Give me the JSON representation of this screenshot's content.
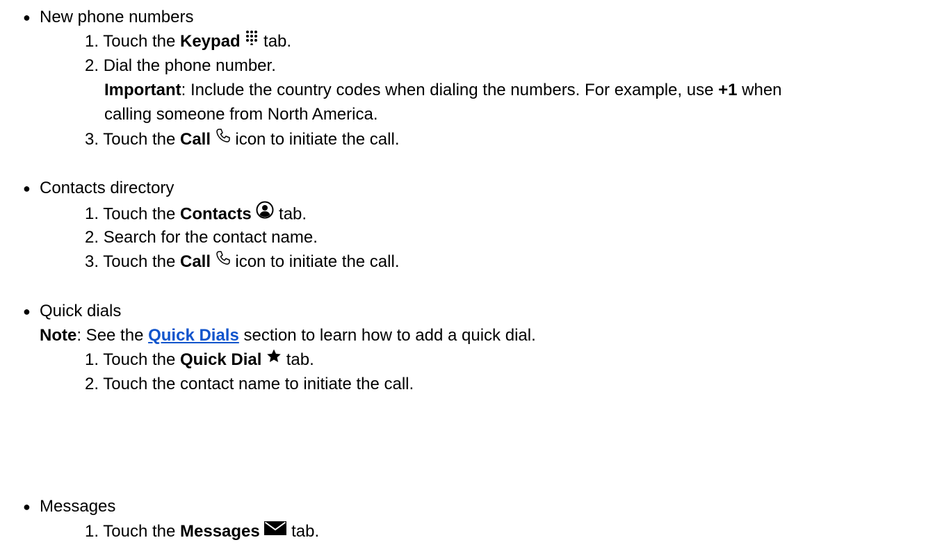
{
  "sections": [
    {
      "bullet": "●",
      "title": "New phone numbers",
      "steps": [
        {
          "num": "1.",
          "pre": "Touch the ",
          "bold": "Keypad",
          "icon": "keypad-icon",
          "post": " tab."
        },
        {
          "num": "2.",
          "text": "Dial the phone number."
        },
        {
          "num": "3.",
          "pre": "Touch the ",
          "bold": "Call",
          "icon": "phone-icon",
          "post": " icon to initiate the call."
        }
      ],
      "important": {
        "label": "Important",
        "text1": ": Include the country codes when dialing the numbers. For example, use ",
        "code": "+1",
        "text2": " when",
        "text3": "calling someone from North America."
      }
    },
    {
      "bullet": "●",
      "title": "Contacts directory",
      "steps": [
        {
          "num": "1.",
          "pre": "Touch the ",
          "bold": "Contacts",
          "icon": "contact-icon",
          "post": " tab."
        },
        {
          "num": "2.",
          "text": "Search for the contact name."
        },
        {
          "num": "3.",
          "pre": "Touch the ",
          "bold": "Call",
          "icon": "phone-icon",
          "post": " icon to initiate the call."
        }
      ]
    },
    {
      "bullet": "●",
      "title": "Quick dials",
      "note": {
        "label": "Note",
        "pre": ": See the ",
        "link": "Quick Dials",
        "post": " section to learn how to add a quick dial."
      },
      "steps": [
        {
          "num": "1.",
          "pre": "Touch the ",
          "bold": "Quick Dial",
          "icon": "star-icon",
          "post": " tab."
        },
        {
          "num": "2.",
          "text": "Touch the contact name to initiate the call."
        }
      ]
    },
    {
      "bullet": "●",
      "title": "Messages",
      "steps": [
        {
          "num": "1.",
          "pre": "Touch the ",
          "bold": "Messages",
          "icon": "envelope-icon",
          "post": " tab."
        }
      ]
    }
  ],
  "colors": {
    "link": "#1155cc",
    "text": "#000000"
  }
}
